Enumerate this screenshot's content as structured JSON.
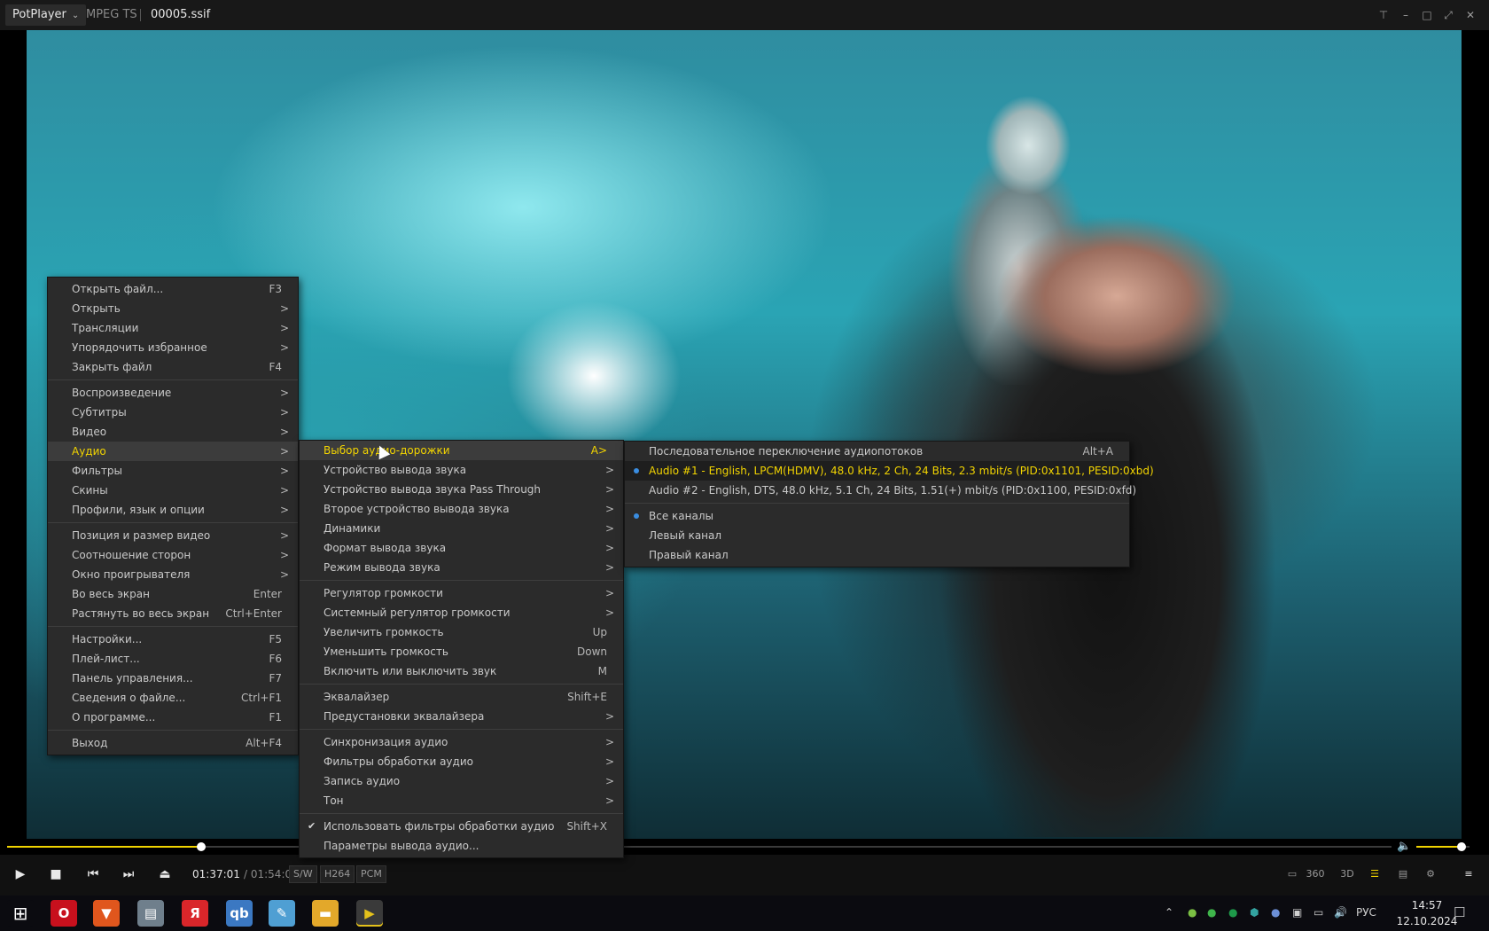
{
  "titlebar": {
    "app": "PotPlayer",
    "format": "MPEG TS",
    "file": "00005.ssif"
  },
  "playback": {
    "current_time": "01:37:01",
    "total_time": "/ 01:54:01",
    "progress": 0.14,
    "volume": 0.85,
    "badges": [
      "S/W",
      "H264",
      "PCM"
    ]
  },
  "right_controls": [
    "monitor-icon",
    "360",
    "3D",
    "playlist-search-icon",
    "list-icon",
    "gear-icon",
    "hamburger-icon"
  ],
  "main_menu": {
    "groups": [
      [
        {
          "label": "Открыть файл...",
          "key": "F3"
        },
        {
          "label": "Открыть",
          "key": ">"
        },
        {
          "label": "Трансляции",
          "key": ">"
        },
        {
          "label": "Упорядочить избранное",
          "key": ">"
        },
        {
          "label": "Закрыть файл",
          "key": "F4"
        }
      ],
      [
        {
          "label": "Воспроизведение",
          "key": ">"
        },
        {
          "label": "Субтитры",
          "key": ">"
        },
        {
          "label": "Видео",
          "key": ">"
        },
        {
          "label": "Аудио",
          "key": ">"
        },
        {
          "label": "Фильтры",
          "key": ">"
        },
        {
          "label": "Скины",
          "key": ">"
        },
        {
          "label": "Профили, язык и опции",
          "key": ">"
        }
      ],
      [
        {
          "label": "Позиция и размер видео",
          "key": ">"
        },
        {
          "label": "Соотношение сторон",
          "key": ">"
        },
        {
          "label": "Окно проигрывателя",
          "key": ">"
        },
        {
          "label": "Во весь экран",
          "key": "Enter"
        },
        {
          "label": "Растянуть во весь экран",
          "key": "Ctrl+Enter"
        }
      ],
      [
        {
          "label": "Настройки...",
          "key": "F5"
        },
        {
          "label": "Плей-лист...",
          "key": "F6"
        },
        {
          "label": "Панель управления...",
          "key": "F7"
        },
        {
          "label": "Сведения о файле...",
          "key": "Ctrl+F1"
        },
        {
          "label": "О программе...",
          "key": "F1"
        }
      ],
      [
        {
          "label": "Выход",
          "key": "Alt+F4"
        }
      ]
    ]
  },
  "audio_menu": {
    "groups": [
      [
        {
          "label": "Выбор аудио-дорожки",
          "key": "A>"
        },
        {
          "label": "Устройство вывода звука",
          "key": ">"
        },
        {
          "label": "Устройство вывода звука Pass Through",
          "key": ">"
        },
        {
          "label": "Второе устройство вывода звука",
          "key": ">"
        },
        {
          "label": "Динамики",
          "key": ">"
        },
        {
          "label": "Формат вывода звука",
          "key": ">"
        },
        {
          "label": "Режим вывода звука",
          "key": ">"
        }
      ],
      [
        {
          "label": "Регулятор громкости",
          "key": ">"
        },
        {
          "label": "Системный регулятор громкости",
          "key": ">"
        },
        {
          "label": "Увеличить громкость",
          "key": "Up"
        },
        {
          "label": "Уменьшить громкость",
          "key": "Down"
        },
        {
          "label": "Включить или выключить звук",
          "key": "M"
        }
      ],
      [
        {
          "label": "Эквалайзер",
          "key": "Shift+E"
        },
        {
          "label": "Предустановки эквалайзера",
          "key": ">"
        }
      ],
      [
        {
          "label": "Синхронизация аудио",
          "key": ">"
        },
        {
          "label": "Фильтры обработки аудио",
          "key": ">"
        },
        {
          "label": "Запись аудио",
          "key": ">"
        },
        {
          "label": "Тон",
          "key": ">"
        }
      ],
      [
        {
          "label": "Использовать фильтры обработки аудио",
          "key": "Shift+X",
          "checked": true
        },
        {
          "label": "Параметры вывода аудио...",
          "key": ""
        }
      ]
    ]
  },
  "track_menu": {
    "groups": [
      [
        {
          "label": "Последовательное переключение аудиопотоков",
          "key": "Alt+A"
        },
        {
          "label": "Audio #1 - English, LPCM(HDMV), 48.0 kHz, 2 Ch, 24 Bits, 2.3 mbit/s (PID:0x1101, PESID:0xbd)",
          "key": "",
          "radio": true,
          "selected": true
        },
        {
          "label": "Audio #2 - English, DTS, 48.0 kHz, 5.1 Ch, 24 Bits, 1.51(+) mbit/s (PID:0x1100, PESID:0xfd)",
          "key": ""
        }
      ],
      [
        {
          "label": "Все каналы",
          "key": "",
          "radio": true
        },
        {
          "label": "Левый канал",
          "key": ""
        },
        {
          "label": "Правый канал",
          "key": ""
        }
      ]
    ]
  },
  "taskbar": {
    "apps": [
      {
        "name": "windows-start-icon",
        "glyph": "⊞",
        "color": "#0b0b10"
      },
      {
        "name": "opera-icon",
        "glyph": "O",
        "color": "#c8101d"
      },
      {
        "name": "brave-icon",
        "glyph": "▼",
        "color": "#e0561d"
      },
      {
        "name": "scanner-app-icon",
        "glyph": "▤",
        "color": "#6f7f8c"
      },
      {
        "name": "yandex-browser-icon",
        "glyph": "Я",
        "color": "#d9262a"
      },
      {
        "name": "qbittorrent-icon",
        "glyph": "qb",
        "color": "#3b78c2"
      },
      {
        "name": "notepad-icon",
        "glyph": "✎",
        "color": "#4f9fd3"
      },
      {
        "name": "file-explorer-icon",
        "glyph": "▬",
        "color": "#e3a82a"
      },
      {
        "name": "potplayer-taskbar-icon",
        "glyph": "▶",
        "color": "#e4c11b"
      }
    ],
    "language": "РУС",
    "time": "14:57",
    "date": "12.10.2024"
  },
  "colors": {
    "accent": "#f2d400",
    "menu_bg": "#2b2b2b",
    "radio": "#3a8de0"
  }
}
